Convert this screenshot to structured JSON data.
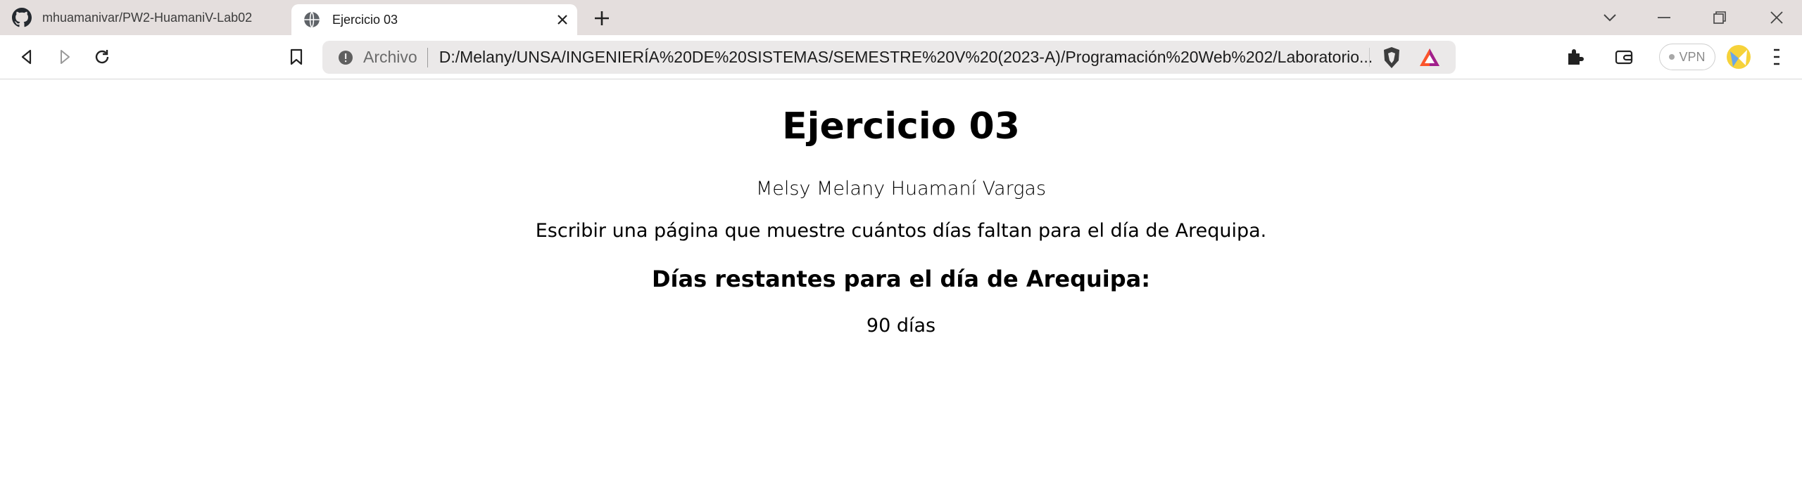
{
  "tabs": [
    {
      "title": "mhuamanivar/PW2-HuamaniV-Lab02",
      "icon": "github-icon",
      "active": false
    },
    {
      "title": "Ejercicio 03",
      "icon": "globe-icon",
      "active": true
    }
  ],
  "toolbar": {
    "scheme_label": "Archivo",
    "url": "D:/Melany/UNSA/INGENIERÍA%20DE%20SISTEMAS/SEMESTRE%20V%20(2023-A)/Programación%20Web%202/Laboratorio...",
    "vpn_label": "VPN"
  },
  "page": {
    "title": "Ejercicio 03",
    "author": "Melsy Melany Huamaní Vargas",
    "description": "Escribir una página que muestre cuántos días faltan para el día de Arequipa.",
    "subheading": "Días restantes para el día de Arequipa:",
    "result": "90 días"
  },
  "colors": {
    "tabstrip_bg": "#e4dedd",
    "omnibox_bg": "#ebe9e9",
    "brave_orange": "#fb542b"
  }
}
